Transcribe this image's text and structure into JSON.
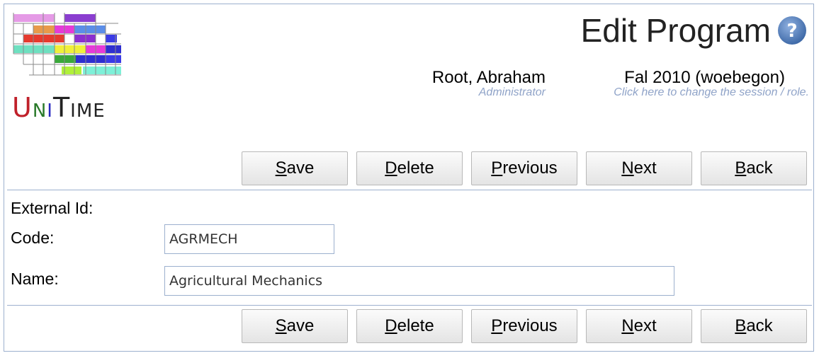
{
  "app": {
    "logo_text": [
      "U",
      "N",
      "I",
      "T",
      "I",
      "M",
      "E"
    ]
  },
  "header": {
    "title": "Edit Program",
    "user_name": "Root, Abraham",
    "user_role": "Administrator",
    "session_name": "Fal 2010 (woebegon)",
    "session_hint": "Click here to change the session / role."
  },
  "buttons": {
    "save": {
      "accel": "S",
      "rest": "ave"
    },
    "delete": {
      "accel": "D",
      "rest": "elete"
    },
    "previous": {
      "accel": "P",
      "rest": "revious"
    },
    "next": {
      "accel": "N",
      "rest": "ext"
    },
    "back": {
      "accel": "B",
      "rest": "ack"
    }
  },
  "form": {
    "external_id_label": "External Id:",
    "code_label": "Code:",
    "code_value": "AGRMECH",
    "name_label": "Name:",
    "name_value": "Agricultural Mechanics"
  },
  "colors": {
    "border": "#9cb0ce",
    "hint": "#8fa3c8"
  }
}
